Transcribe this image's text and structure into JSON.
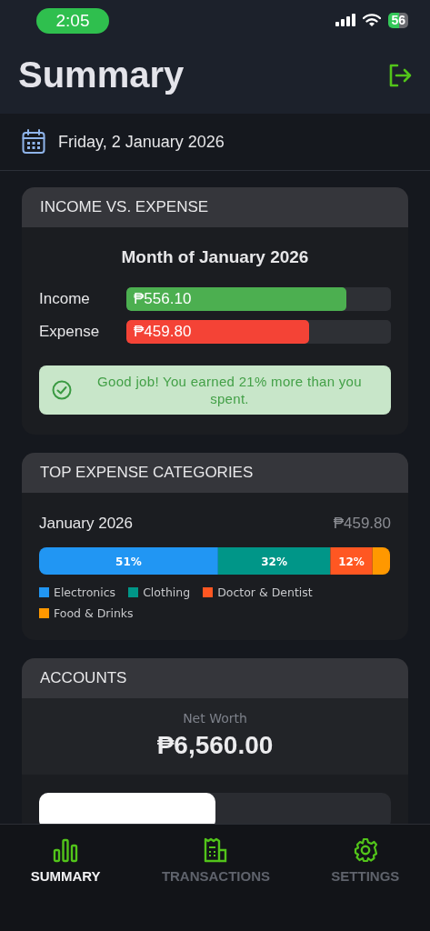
{
  "status_bar": {
    "time": "2:05",
    "battery": "56"
  },
  "header": {
    "title": "Summary"
  },
  "date_bar": {
    "date": "Friday, 2 January 2026"
  },
  "income_expense": {
    "title": "INCOME VS. EXPENSE",
    "subtitle": "Month of January 2026",
    "bars": [
      {
        "kind": "income",
        "label": "Income",
        "amount": "₱556.10",
        "level": 0.83
      },
      {
        "kind": "expense",
        "label": "Expense",
        "amount": "₱459.80",
        "level": 0.69
      }
    ],
    "message": "Good job! You earned 21% more than you spent."
  },
  "top_expenses": {
    "title": "TOP EXPENSE CATEGORIES",
    "period": "January 2026",
    "total": "₱459.80",
    "chart_data": {
      "type": "bar",
      "orientation": "horizontal",
      "stacked": true,
      "xlim": [
        0,
        100
      ],
      "series": [
        {
          "name": "Electronics",
          "color": "#2196f3",
          "values": [
            51
          ],
          "value_labels": [
            "51%"
          ]
        },
        {
          "name": "Clothing",
          "color": "#009688",
          "values": [
            32
          ],
          "value_labels": [
            "32%"
          ]
        },
        {
          "name": "Doctor & Dentist",
          "color": "#ff5722",
          "values": [
            12
          ],
          "value_labels": [
            "12%"
          ]
        },
        {
          "name": "Food & Drinks",
          "color": "#ff9800",
          "values": [
            5
          ],
          "value_labels": [
            null
          ]
        }
      ]
    }
  },
  "accounts": {
    "title": "ACCOUNTS",
    "net_worth_label": "Net Worth",
    "net_worth": "₱6,560.00"
  },
  "tab_bar": [
    {
      "kind": "summary",
      "label": "SUMMARY",
      "selected": true
    },
    {
      "kind": "transactions",
      "label": "TRANSACTIONS",
      "selected": false
    },
    {
      "kind": "settings",
      "label": "SETTINGS",
      "selected": false
    }
  ]
}
